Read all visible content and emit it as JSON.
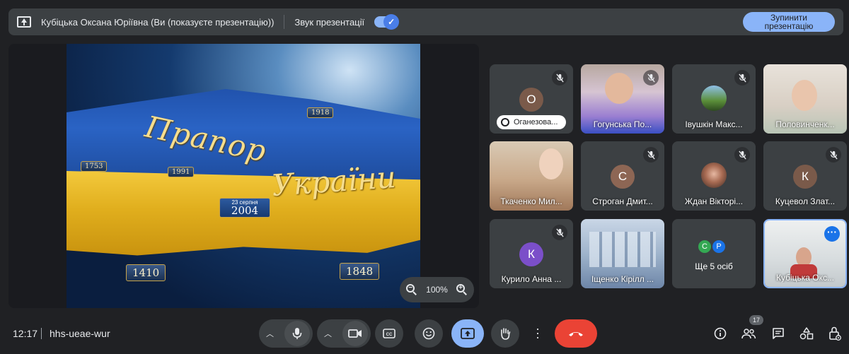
{
  "top_bar": {
    "presenter": "Кубіцька Оксана Юріївна (Ви (показуєте презентацію))",
    "audio_label": "Звук презентації",
    "audio_on": true,
    "stop_button": "Зупинити презентацію"
  },
  "slide": {
    "title_line1": "Прапор",
    "title_line2": "України",
    "plaques": [
      "1918",
      "1753",
      "1991",
      "1410",
      "1848"
    ],
    "date_small": "23 серпня",
    "date_year": "2004"
  },
  "zoom": {
    "level": "100%"
  },
  "participants": [
    {
      "name": "Оганезова...",
      "kind": "avatar",
      "initial": "О",
      "color": "#7a5a4a",
      "pill": true
    },
    {
      "name": "Гогунська По...",
      "kind": "video",
      "muted": true
    },
    {
      "name": "Івушкін Макс...",
      "kind": "photo",
      "muted": true
    },
    {
      "name": "Половинченк...",
      "kind": "video",
      "muted": false
    },
    {
      "name": "Ткаченко Мил...",
      "kind": "video",
      "muted": false
    },
    {
      "name": "Строган Дмит...",
      "kind": "avatar",
      "initial": "С",
      "color": "#8d6654",
      "muted": true
    },
    {
      "name": "Ждан Вікторі...",
      "kind": "photo",
      "muted": true
    },
    {
      "name": "Куцевол Злат...",
      "kind": "avatar",
      "initial": "К",
      "color": "#7a5a4a",
      "muted": true
    },
    {
      "name": "Курило Анна ...",
      "kind": "avatar",
      "initial": "К",
      "color": "#7b4fc9",
      "muted": true
    },
    {
      "name": "Іщенко Кірілл ...",
      "kind": "video",
      "muted": false
    },
    {
      "name": "Кубіцька Окс...",
      "kind": "video",
      "muted": false,
      "self": true
    }
  ],
  "others": {
    "label": "Ще 5 осіб",
    "avatars": [
      {
        "initial": "С",
        "color": "#34a853"
      },
      {
        "initial": "Р",
        "color": "#1a73e8"
      }
    ]
  },
  "bottom_bar": {
    "time": "12:17",
    "meeting_code": "hhs-ueae-wur",
    "people_count": "17"
  },
  "colors": {
    "accent": "#8ab4f8",
    "end_call": "#ea4335",
    "background": "#202124"
  }
}
